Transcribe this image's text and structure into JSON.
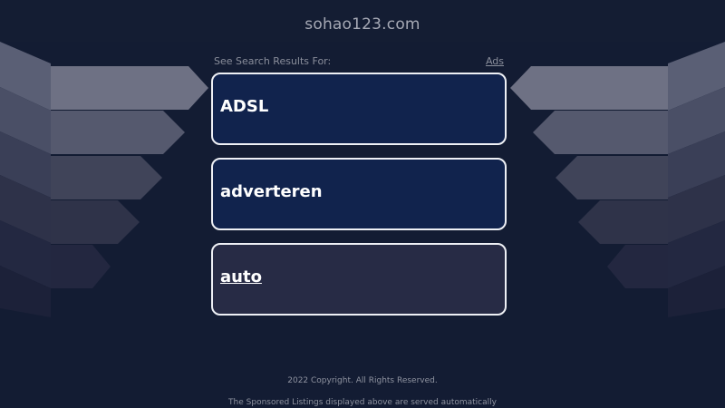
{
  "site": {
    "domain": "sohao123.com"
  },
  "results": {
    "header_label": "See Search Results For:",
    "ads_label": "Ads",
    "items": [
      {
        "label": "ADSL"
      },
      {
        "label": "adverteren"
      },
      {
        "label": "auto"
      }
    ]
  },
  "footer": {
    "copyright": "2022 Copyright. All Rights Reserved.",
    "disclaimer": "The Sponsored Listings displayed above are served automatically"
  },
  "colors": {
    "background": "#131c33",
    "card_primary": "#11234d",
    "card_secondary": "#272b45",
    "card_border": "#eef0f5"
  }
}
